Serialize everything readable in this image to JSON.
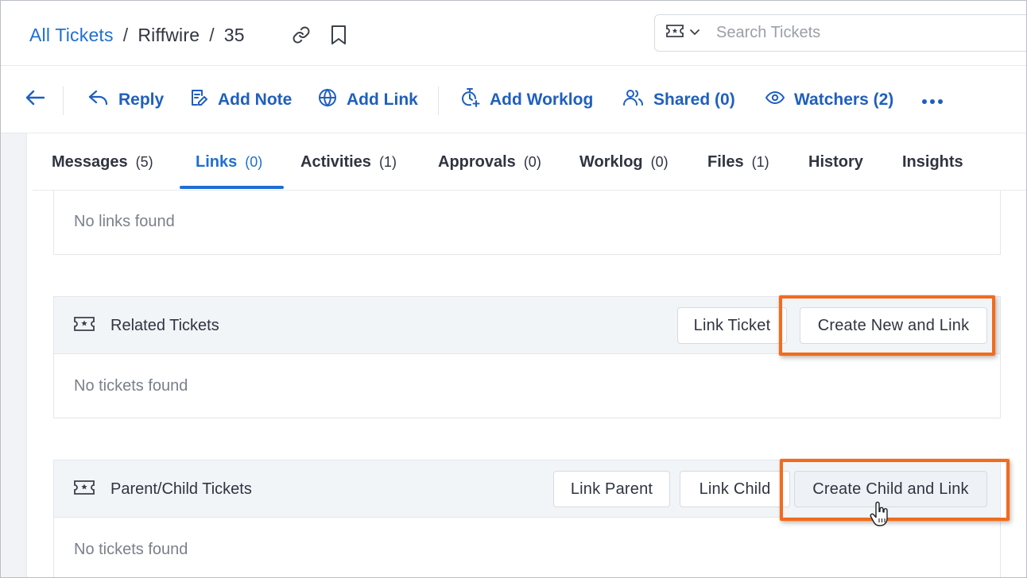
{
  "breadcrumb": {
    "root": "All Tickets",
    "sep": "/",
    "project": "Riffwire",
    "ticket_id": "35"
  },
  "search": {
    "placeholder": "Search Tickets",
    "type_icon": "ticket-icon"
  },
  "toolbar": {
    "reply": "Reply",
    "add_note": "Add Note",
    "add_link": "Add Link",
    "add_worklog": "Add Worklog",
    "shared": "Shared (0)",
    "watchers": "Watchers (2)"
  },
  "tabs": [
    {
      "label": "Messages",
      "count": "(5)"
    },
    {
      "label": "Links",
      "count": "(0)",
      "active": true
    },
    {
      "label": "Activities",
      "count": "(1)"
    },
    {
      "label": "Approvals",
      "count": "(0)"
    },
    {
      "label": "Worklog",
      "count": "(0)"
    },
    {
      "label": "Files",
      "count": "(1)"
    },
    {
      "label": "History",
      "count": ""
    },
    {
      "label": "Insights",
      "count": ""
    }
  ],
  "links_panel": {
    "empty_text": "No links found"
  },
  "related_panel": {
    "title": "Related Tickets",
    "link_button": "Link Ticket",
    "create_button": "Create New and Link",
    "empty_text": "No tickets found"
  },
  "parent_child_panel": {
    "title": "Parent/Child Tickets",
    "link_parent_button": "Link Parent",
    "link_child_button": "Link Child",
    "create_button": "Create Child and Link",
    "empty_text": "No tickets found"
  },
  "colors": {
    "accent": "#1f6fd1",
    "toolbar_text": "#1f5fbf",
    "highlight": "#f26b1d"
  }
}
